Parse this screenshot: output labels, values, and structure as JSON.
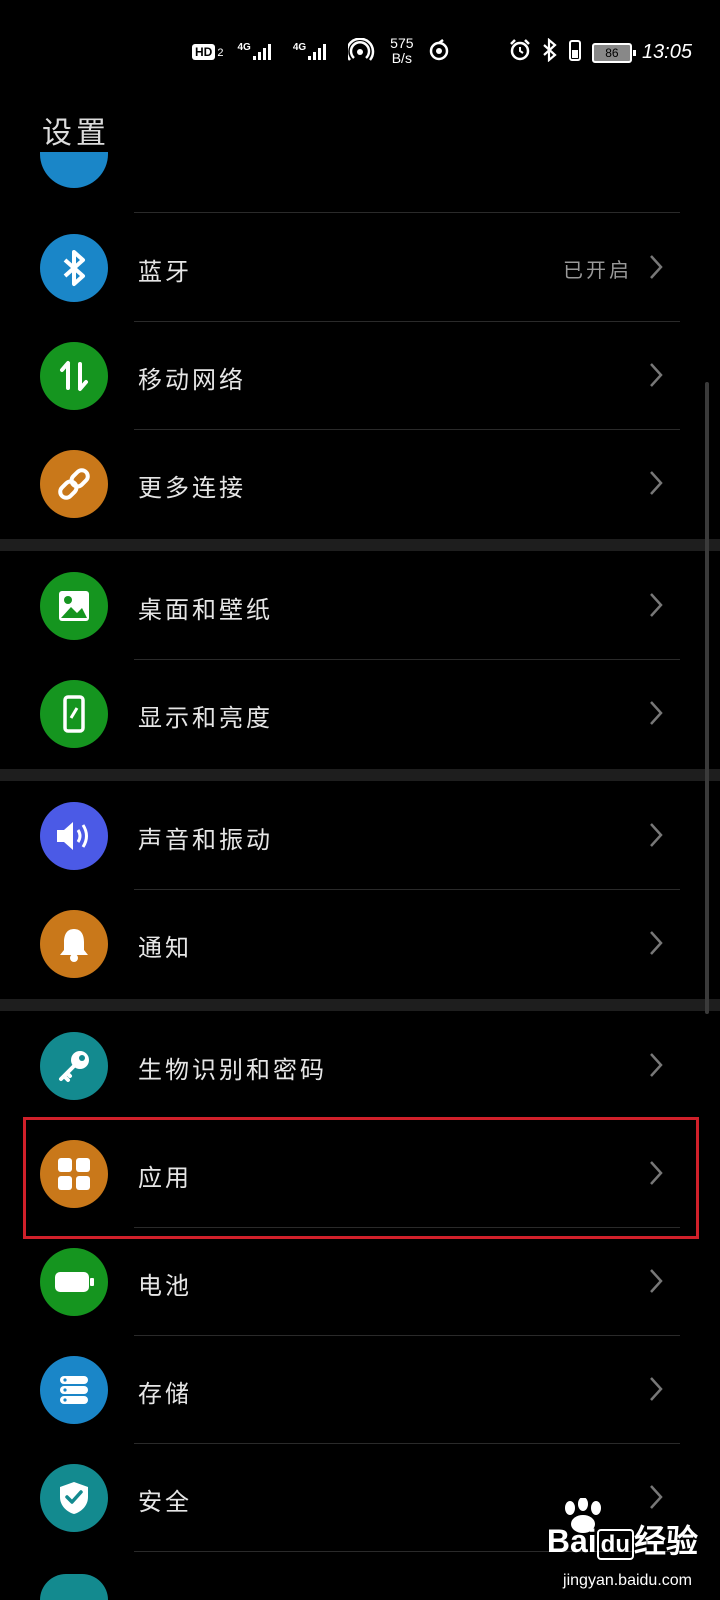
{
  "status_bar": {
    "hd_label": "HD",
    "hd_index": "2",
    "signal1_label": "4G",
    "signal2_label": "4G",
    "net_speed_value": "575",
    "net_speed_unit": "B/s",
    "battery_level": "86",
    "time": "13:05"
  },
  "header": {
    "title": "设置"
  },
  "items": [
    {
      "label": "蓝牙",
      "value": "已开启",
      "icon": "bluetooth-icon",
      "color": "#1a86c8"
    },
    {
      "label": "移动网络",
      "value": "",
      "icon": "mobile-data-icon",
      "color": "#15951f"
    },
    {
      "label": "更多连接",
      "value": "",
      "icon": "link-icon",
      "color": "#c9781a"
    },
    {
      "label": "桌面和壁纸",
      "value": "",
      "icon": "image-icon",
      "color": "#15951f"
    },
    {
      "label": "显示和亮度",
      "value": "",
      "icon": "phone-brightness-icon",
      "color": "#15951f"
    },
    {
      "label": "声音和振动",
      "value": "",
      "icon": "speaker-icon",
      "color": "#4b5ae6"
    },
    {
      "label": "通知",
      "value": "",
      "icon": "bell-icon",
      "color": "#c9781a"
    },
    {
      "label": "生物识别和密码",
      "value": "",
      "icon": "key-icon",
      "color": "#138a8f"
    },
    {
      "label": "应用",
      "value": "",
      "icon": "apps-grid-icon",
      "color": "#c9781a"
    },
    {
      "label": "电池",
      "value": "",
      "icon": "battery-icon",
      "color": "#15951f"
    },
    {
      "label": "存储",
      "value": "",
      "icon": "storage-icon",
      "color": "#1a86c8"
    },
    {
      "label": "安全",
      "value": "",
      "icon": "shield-check-icon",
      "color": "#138a8f"
    }
  ],
  "watermark": {
    "brand_latin": "Bai",
    "brand_du": "du",
    "brand_cn": "经验",
    "url": "jingyan.baidu.com"
  },
  "colors": {
    "background": "#000000",
    "section_gap": "#1e1e1e",
    "highlight": "#d0202a"
  }
}
